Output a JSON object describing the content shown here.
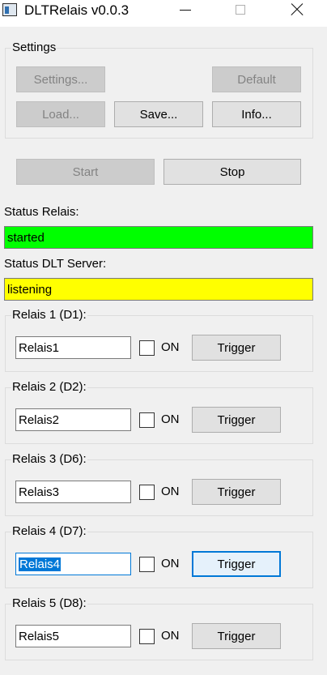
{
  "window": {
    "title": "DLTRelais v0.0.3",
    "icon": "app-icon",
    "controls": {
      "minimize": "minimize-icon",
      "maximize": "maximize-icon",
      "close": "close-icon"
    }
  },
  "settings": {
    "group_label": "Settings",
    "settings_btn": "Settings...",
    "default_btn": "Default",
    "load_btn": "Load...",
    "save_btn": "Save...",
    "info_btn": "Info..."
  },
  "controls": {
    "start_btn": "Start",
    "stop_btn": "Stop"
  },
  "status_relais": {
    "label": "Status Relais:",
    "value": "started",
    "color": "#00ff00"
  },
  "status_dlt": {
    "label": "Status DLT Server:",
    "value": "listening",
    "color": "#ffff00"
  },
  "relais": [
    {
      "label": "Relais 1 (D1):",
      "name": "Relais1",
      "on_label": "ON",
      "checked": false,
      "trigger": "Trigger"
    },
    {
      "label": "Relais 2 (D2):",
      "name": "Relais2",
      "on_label": "ON",
      "checked": false,
      "trigger": "Trigger"
    },
    {
      "label": "Relais 3 (D6):",
      "name": "Relais3",
      "on_label": "ON",
      "checked": false,
      "trigger": "Trigger"
    },
    {
      "label": "Relais 4 (D7):",
      "name": "Relais4",
      "on_label": "ON",
      "checked": false,
      "trigger": "Trigger",
      "focused": true
    },
    {
      "label": "Relais 5 (D8):",
      "name": "Relais5",
      "on_label": "ON",
      "checked": false,
      "trigger": "Trigger"
    }
  ],
  "colors": {
    "focus_accent": "#0078d7",
    "disabled_text": "#838383"
  }
}
